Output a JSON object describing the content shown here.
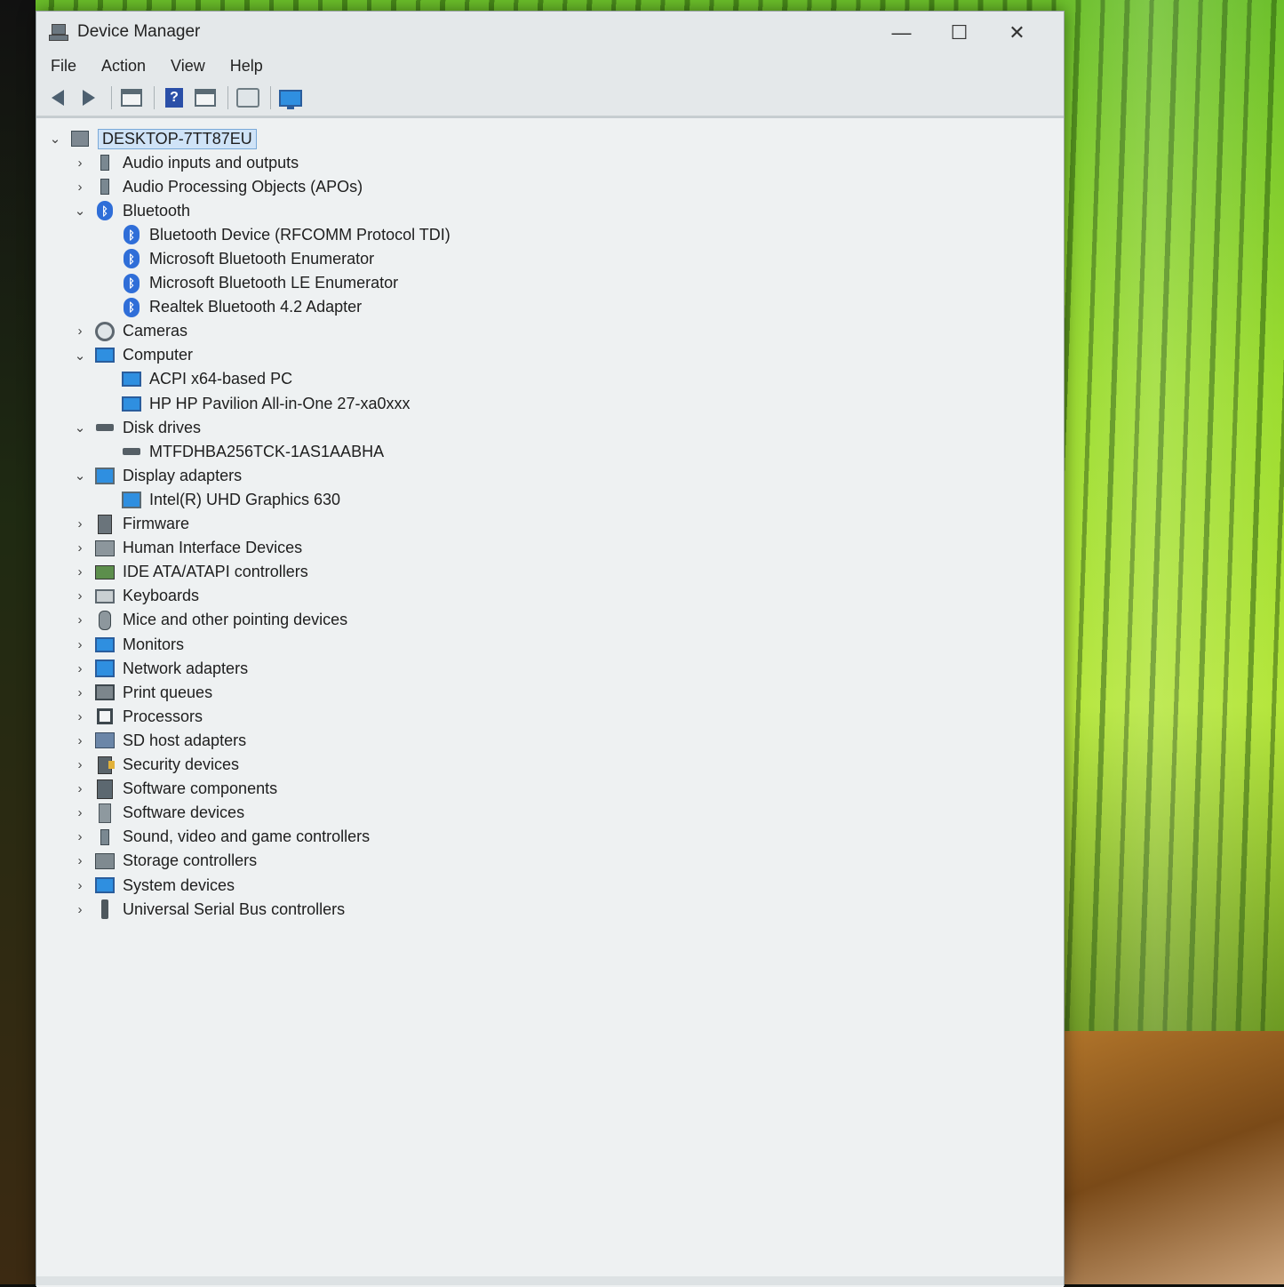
{
  "window": {
    "title": "Device Manager",
    "controls": {
      "minimize": "—",
      "maximize": "☐",
      "close": "✕"
    }
  },
  "menu": [
    "File",
    "Action",
    "View",
    "Help"
  ],
  "toolbar": [
    {
      "name": "back-icon"
    },
    {
      "name": "forward-icon"
    },
    {
      "name": "properties-icon"
    },
    {
      "name": "help-icon",
      "glyph": "?"
    },
    {
      "name": "update-driver-icon"
    },
    {
      "name": "scan-hardware-icon"
    },
    {
      "name": "monitor-icon"
    }
  ],
  "tree": {
    "root": {
      "label": "DESKTOP-7TT87EU",
      "expanded": true,
      "selected": true
    },
    "nodes": [
      {
        "label": "Audio inputs and outputs",
        "icon": "speaker-icon",
        "level": 1,
        "expanded": false
      },
      {
        "label": "Audio Processing Objects (APOs)",
        "icon": "speaker-icon",
        "level": 1,
        "expanded": false
      },
      {
        "label": "Bluetooth",
        "icon": "bluetooth-icon",
        "level": 1,
        "expanded": true
      },
      {
        "label": "Bluetooth Device (RFCOMM Protocol TDI)",
        "icon": "bluetooth-icon",
        "level": 2
      },
      {
        "label": "Microsoft Bluetooth Enumerator",
        "icon": "bluetooth-icon",
        "level": 2
      },
      {
        "label": "Microsoft Bluetooth LE Enumerator",
        "icon": "bluetooth-icon",
        "level": 2
      },
      {
        "label": "Realtek Bluetooth 4.2 Adapter",
        "icon": "bluetooth-icon",
        "level": 2
      },
      {
        "label": "Cameras",
        "icon": "camera-icon",
        "level": 1,
        "expanded": false
      },
      {
        "label": "Computer",
        "icon": "computer-icon",
        "level": 1,
        "expanded": true
      },
      {
        "label": "ACPI x64-based PC",
        "icon": "computer-icon",
        "level": 2
      },
      {
        "label": "HP HP Pavilion All-in-One 27-xa0xxx",
        "icon": "computer-icon",
        "level": 2
      },
      {
        "label": "Disk drives",
        "icon": "disk-icon",
        "level": 1,
        "expanded": true
      },
      {
        "label": "MTFDHBA256TCK-1AS1AABHA",
        "icon": "disk-icon",
        "level": 2
      },
      {
        "label": "Display adapters",
        "icon": "display-adapter-icon",
        "level": 1,
        "expanded": true
      },
      {
        "label": "Intel(R) UHD Graphics 630",
        "icon": "display-adapter-icon",
        "level": 2
      },
      {
        "label": "Firmware",
        "icon": "firmware-icon",
        "level": 1,
        "expanded": false
      },
      {
        "label": "Human Interface Devices",
        "icon": "hid-icon",
        "level": 1,
        "expanded": false
      },
      {
        "label": "IDE ATA/ATAPI controllers",
        "icon": "ide-icon",
        "level": 1,
        "expanded": false
      },
      {
        "label": "Keyboards",
        "icon": "keyboard-icon",
        "level": 1,
        "expanded": false
      },
      {
        "label": "Mice and other pointing devices",
        "icon": "mouse-icon",
        "level": 1,
        "expanded": false
      },
      {
        "label": "Monitors",
        "icon": "monitor-icon",
        "level": 1,
        "expanded": false
      },
      {
        "label": "Network adapters",
        "icon": "network-icon",
        "level": 1,
        "expanded": false
      },
      {
        "label": "Print queues",
        "icon": "printer-icon",
        "level": 1,
        "expanded": false
      },
      {
        "label": "Processors",
        "icon": "processor-icon",
        "level": 1,
        "expanded": false
      },
      {
        "label": "SD host adapters",
        "icon": "sd-card-icon",
        "level": 1,
        "expanded": false
      },
      {
        "label": "Security devices",
        "icon": "security-icon",
        "level": 1,
        "expanded": false
      },
      {
        "label": "Software components",
        "icon": "software-component-icon",
        "level": 1,
        "expanded": false
      },
      {
        "label": "Software devices",
        "icon": "software-device-icon",
        "level": 1,
        "expanded": false
      },
      {
        "label": "Sound, video and game controllers",
        "icon": "speaker-icon",
        "level": 1,
        "expanded": false
      },
      {
        "label": "Storage controllers",
        "icon": "storage-icon",
        "level": 1,
        "expanded": false
      },
      {
        "label": "System devices",
        "icon": "system-icon",
        "level": 1,
        "expanded": false
      },
      {
        "label": "Universal Serial Bus controllers",
        "icon": "usb-icon",
        "level": 1,
        "expanded": false
      }
    ]
  }
}
